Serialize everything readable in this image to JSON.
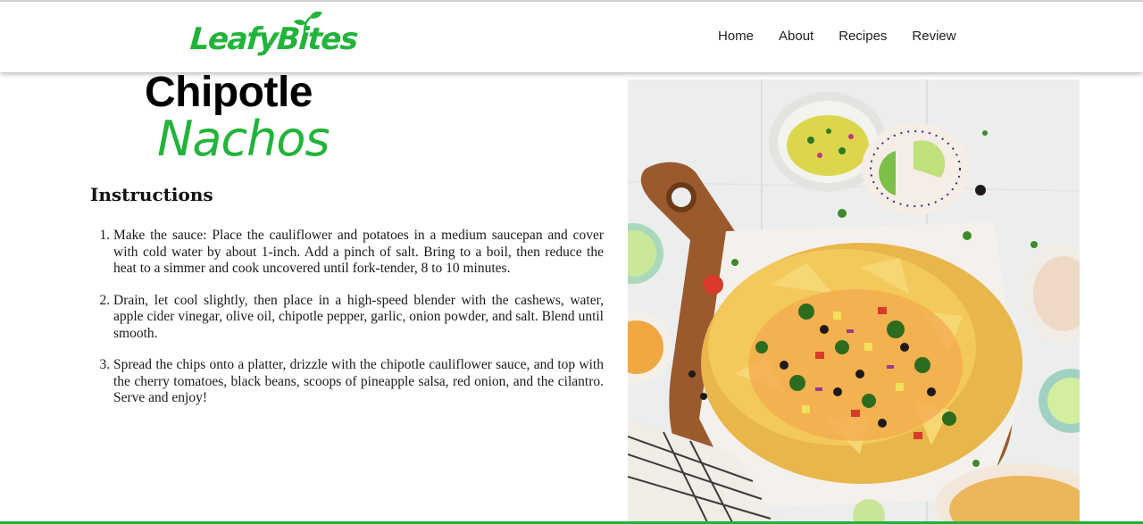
{
  "brand": {
    "name": "LeafyBites",
    "logo_color": "#22b33b",
    "icon": "sprout-icon"
  },
  "nav": {
    "items": [
      {
        "label": "Home"
      },
      {
        "label": "About"
      },
      {
        "label": "Recipes"
      },
      {
        "label": "Review"
      }
    ]
  },
  "recipe": {
    "title_line1": "Chipotle",
    "title_line2": "Nachos",
    "accent_color": "#22b33b",
    "instructions_heading": "Instructions",
    "steps": [
      "Make the sauce: Place the cauliflower and potatoes in a medium saucepan and cover with cold water by about 1-inch. Add a pinch of salt. Bring to a boil, then reduce the heat to a simmer and cook uncovered until fork-tender, 8 to 10 minutes.",
      "Drain, let cool slightly, then place in a high-speed blender with the cashews, water, apple cider vinegar, olive oil, chipotle pepper, garlic, onion powder, and salt. Blend until smooth.",
      "Spread the chips onto a platter, drizzle with the chipotle cauliflower sauce, and top with the cherry tomatoes, black beans, scoops of pineapple salsa, red onion, and the cilantro. Serve and enjoy!"
    ]
  }
}
